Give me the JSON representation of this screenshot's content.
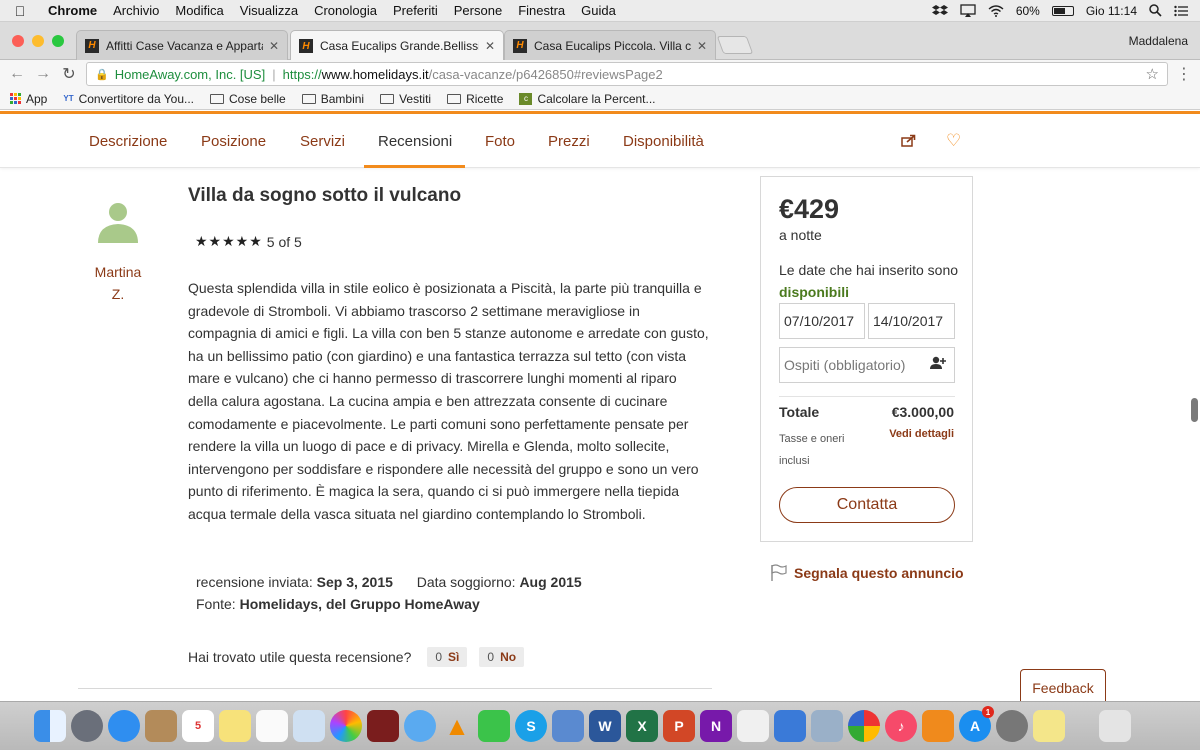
{
  "menubar": {
    "items": [
      "Chrome",
      "Archivio",
      "Modifica",
      "Visualizza",
      "Cronologia",
      "Preferiti",
      "Persone",
      "Finestra",
      "Guida"
    ],
    "battery": "60%",
    "battery_level": 0.6,
    "clock": "Gio 11:14"
  },
  "tabs": [
    {
      "title": "Affitti Case Vacanza e Apparta"
    },
    {
      "title": "Casa Eucalips Grande.Bellissim"
    },
    {
      "title": "Casa Eucalips Piccola. Villa con"
    }
  ],
  "profile_name": "Maddalena",
  "address": {
    "ev_label": "HomeAway.com, Inc. [US]",
    "scheme": "https://",
    "host": "www.homelidays.it",
    "path": "/casa-vacanze/p6426850#reviewsPage2"
  },
  "bookmarks": [
    "App",
    "Convertitore da You...",
    "Cose belle",
    "Bambini",
    "Vestiti",
    "Ricette",
    "Calcolare la Percent..."
  ],
  "subnav": {
    "links": [
      "Descrizione",
      "Posizione",
      "Servizi",
      "Recensioni",
      "Foto",
      "Prezzi",
      "Disponibilità"
    ],
    "active": "Recensioni"
  },
  "review": {
    "reviewer_first": "Martina",
    "reviewer_last": "Z.",
    "title": "Villa da sogno sotto il vulcano",
    "stars": "★★★★★",
    "rating_text": "5 of 5",
    "body": "Questa splendida villa in stile eolico è posizionata a Piscità, la parte più tranquilla e gradevole di Stromboli. Vi abbiamo trascorso 2 settimane meravigliose in compagnia di amici e figli. La villa con ben 5 stanze autonome e arredate con gusto, ha un bellissimo patio (con giardino) e una fantastica terrazza sul tetto (con vista mare e vulcano) che ci hanno permesso di trascorrere lunghi momenti al riparo della calura agostana. La cucina ampia e ben attrezzata consente di cucinare comodamente e piacevolmente. Le parti comuni sono perfettamente pensate per rendere la villa un luogo di pace e di privacy. Mirella e Glenda, molto sollecite, intervengono per soddisfare e rispondere alle necessità del gruppo e sono un vero punto di riferimento. È magica la sera, quando ci si può immergere nella tiepida acqua termale della vasca situata nel giardino contemplando lo Stromboli.",
    "sent_label": "recensione inviata:",
    "sent_date": "Sep 3, 2015",
    "stay_label": "Data soggiorno:",
    "stay_date": "Aug 2015",
    "source_label": "Fonte:",
    "source_value": "Homelidays, del Gruppo HomeAway",
    "helpful_q": "Hai trovato utile questa recensione?",
    "yes_count": "0",
    "yes_label": "Sì",
    "no_count": "0",
    "no_label": "No"
  },
  "booking": {
    "price": "€429",
    "per_night": "a notte",
    "avail_prefix": "Le date che hai inserito sono",
    "avail_status": "disponibili",
    "checkin": "07/10/2017",
    "checkout": "14/10/2017",
    "guests_placeholder": "Ospiti (obbligatorio)",
    "total_label": "Totale",
    "total_value": "€3.000,00",
    "taxes": "Tasse e oneri inclusi",
    "details": "Vedi dettagli",
    "contact": "Contatta"
  },
  "report": "Segnala questo annuncio",
  "feedback": "Feedback",
  "colors": {
    "brand_orange": "#f28b1c",
    "link_brown": "#8b3a17",
    "available_green": "#4b7a1e"
  },
  "icons": [
    "apple-icon",
    "dropbox-icon",
    "airplay-icon",
    "wifi-icon",
    "battery-icon",
    "search-icon",
    "list-icon",
    "lock-icon",
    "star-icon",
    "share-icon",
    "heart-icon",
    "user-icon",
    "flag-icon"
  ]
}
